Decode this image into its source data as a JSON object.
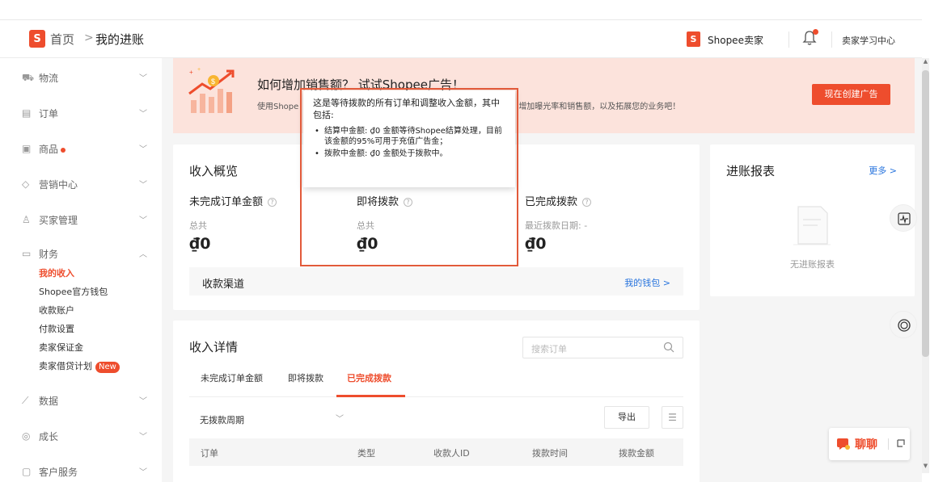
{
  "header": {
    "logo_letter": "S",
    "breadcrumb_home": "首页",
    "breadcrumb_sep": ">",
    "breadcrumb_current": "我的进账",
    "seller_logo_letter": "S",
    "seller_label": "Shopee卖家",
    "learning_center": "卖家学习中心"
  },
  "sidebar": {
    "items": [
      {
        "label": "物流",
        "icon": "truck-icon"
      },
      {
        "label": "订单",
        "icon": "clipboard-icon"
      },
      {
        "label": "商品",
        "icon": "box-icon",
        "dot": true
      },
      {
        "label": "营销中心",
        "icon": "tag-icon"
      },
      {
        "label": "买家管理",
        "icon": "user-icon"
      },
      {
        "label": "财务",
        "icon": "wallet-icon"
      },
      {
        "label": "数据",
        "icon": "chart-icon"
      },
      {
        "label": "成长",
        "icon": "medal-icon"
      },
      {
        "label": "客户服务",
        "icon": "service-icon"
      }
    ],
    "finance_sub": [
      "我的收入",
      "Shopee官方钱包",
      "收款账户",
      "付款设置",
      "卖家保证金",
      "卖家借贷计划"
    ],
    "new_badge": "New"
  },
  "banner": {
    "title": "如何增加销售额？ 试试Shopee广告！",
    "desc_left": "使用Shope",
    "desc_right": "增加曝光率和销售额，以及拓展您的业务吧！",
    "button": "现在创建广告"
  },
  "overview": {
    "title": "收入概览",
    "columns": [
      {
        "title": "未完成订单金额",
        "sub": "总共",
        "amount": "₫0"
      },
      {
        "title": "即将拨款",
        "sub": "总共",
        "amount": "₫0"
      },
      {
        "title": "已完成拨款",
        "sub": "最近拨款日期: -",
        "amount": "₫0"
      }
    ],
    "channel_label": "收款渠道",
    "wallet_link": "我的钱包 >"
  },
  "report": {
    "title": "进账报表",
    "more": "更多 >",
    "empty": "无进账报表"
  },
  "details": {
    "title": "收入详情",
    "search_placeholder": "搜索订单",
    "tabs": [
      "未完成订单金额",
      "即将拨款",
      "已完成拨款"
    ],
    "active_tab": 2,
    "period": "无拨款周期",
    "export": "导出",
    "columns": [
      "订单",
      "类型",
      "收款人ID",
      "拨款时间",
      "拨款金额"
    ]
  },
  "tooltip": {
    "intro": "这是等待拨款的所有订单和调整收入金额，其中包括:",
    "items": [
      "结算中金额: ₫0 金额等待Shopee结算处理，目前该金额的95%可用于充值广告金；",
      "拨款中金额: ₫0 金额处于拨款中。"
    ]
  },
  "chat": {
    "label": "聊聊"
  },
  "colors": {
    "brand": "#ee4d2d",
    "link": "#2673dd",
    "banner_bg": "#fce3dc"
  }
}
